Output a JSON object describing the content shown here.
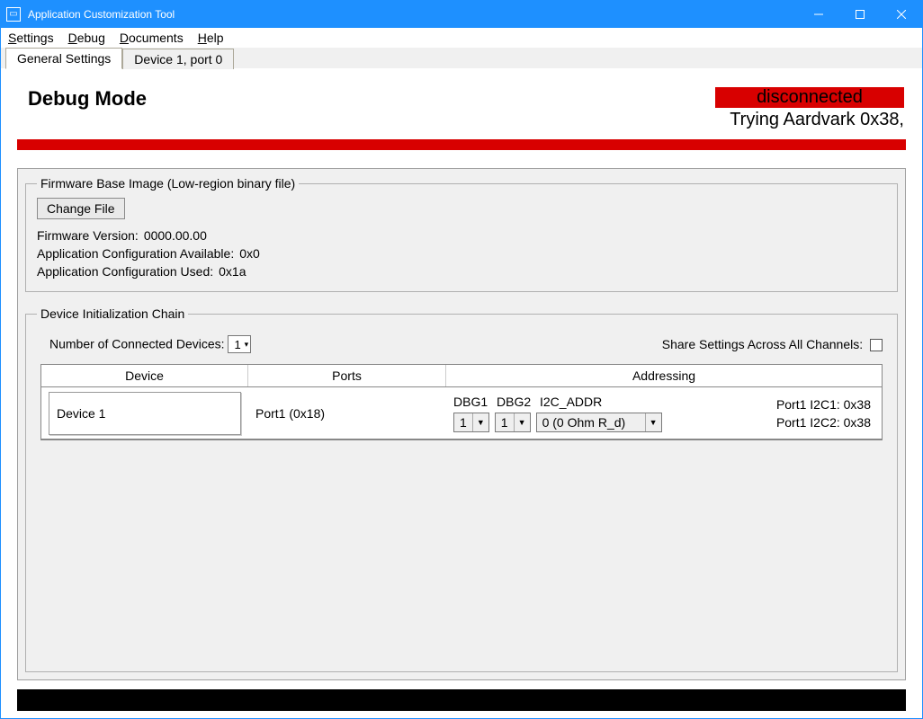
{
  "window": {
    "title": "Application Customization Tool"
  },
  "menu": {
    "settings": "Settings",
    "debug": "Debug",
    "documents": "Documents",
    "help": "Help"
  },
  "tabs": {
    "general": "General Settings",
    "device1": "Device 1, port 0"
  },
  "header": {
    "mode": "Debug Mode",
    "status": "disconnected",
    "status_sub": "Trying Aardvark 0x38,"
  },
  "firmware": {
    "legend": "Firmware Base Image (Low-region binary file)",
    "change_file": "Change File",
    "version_label": "Firmware Version:",
    "version_value": "0000.00.00",
    "appcfg_avail_label": "Application Configuration Available:",
    "appcfg_avail_value": "0x0",
    "appcfg_used_label": "Application Configuration Used:",
    "appcfg_used_value": "0x1a"
  },
  "devchain": {
    "legend": "Device Initialization Chain",
    "num_label": "Number of Connected Devices:",
    "num_value": "1",
    "share_label": "Share Settings Across All Channels:",
    "th_device": "Device",
    "th_ports": "Ports",
    "th_addr": "Addressing",
    "row": {
      "device": "Device 1",
      "ports": "Port1 (0x18)",
      "dbg1_label": "DBG1",
      "dbg2_label": "DBG2",
      "i2caddr_label": "I2C_ADDR",
      "dbg1_value": "1",
      "dbg2_value": "1",
      "i2caddr_value": "0 (0 Ohm R_d)",
      "i2c1": "Port1 I2C1: 0x38",
      "i2c2": "Port1 I2C2: 0x38"
    }
  }
}
